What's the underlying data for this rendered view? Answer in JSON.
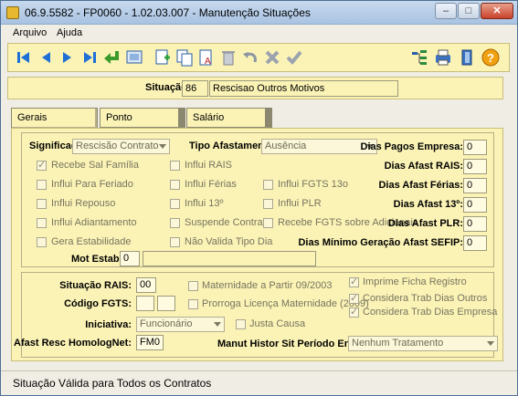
{
  "window": {
    "title": "06.9.5582 - FP0060 - 1.02.03.007 - Manutenção Situações"
  },
  "window_controls": {
    "minimize": "–",
    "maximize": "□",
    "close": "✕"
  },
  "menu": [
    "Arquivo",
    "Ajuda"
  ],
  "situacao": {
    "label": "Situação:",
    "code": "86",
    "description": "Rescisao Outros Motivos"
  },
  "tabs": [
    "Gerais",
    "Ponto",
    "Salário"
  ],
  "gerais": {
    "significado": {
      "label": "Significado:",
      "value": "Rescisão Contrato"
    },
    "tipo_afastamento": {
      "label": "Tipo Afastamento:",
      "value": "Ausência"
    },
    "checkboxes_col1": [
      {
        "label": "Recebe Sal Família",
        "checked": true
      },
      {
        "label": "Influi Para Feriado",
        "checked": false
      },
      {
        "label": "Influi Repouso",
        "checked": false
      },
      {
        "label": "Influi Adiantamento",
        "checked": false
      },
      {
        "label": "Gera Estabilidade",
        "checked": false
      }
    ],
    "checkboxes_col2": [
      {
        "label": "Influi RAIS",
        "checked": false
      },
      {
        "label": "Influi Férias",
        "checked": false
      },
      {
        "label": "Influi 13º",
        "checked": false
      },
      {
        "label": "Suspende Contrato",
        "checked": false
      },
      {
        "label": "Não Valida Tipo Dia",
        "checked": false
      }
    ],
    "checkboxes_col3": [
      {
        "label": "Influi FGTS 13o",
        "checked": false
      },
      {
        "label": "Influi PLR",
        "checked": false
      },
      {
        "label": "Recebe FGTS sobre Adicionais",
        "checked": false
      }
    ],
    "dias": [
      {
        "label": "Dias Pagos Empresa:",
        "value": "0"
      },
      {
        "label": "Dias Afast RAIS:",
        "value": "0"
      },
      {
        "label": "Dias Afast Férias:",
        "value": "0"
      },
      {
        "label": "Dias Afast 13º:",
        "value": "0"
      },
      {
        "label": "Dias Afast PLR:",
        "value": "0"
      },
      {
        "label": "Dias Mínimo Geração Afast SEFIP:",
        "value": "0"
      }
    ],
    "mot_estab": {
      "label": "Mot Estab:",
      "value": "0",
      "description": ""
    }
  },
  "lower": {
    "situacao_rais": {
      "label": "Situação RAIS:",
      "value": "00"
    },
    "codigo_fgts": {
      "label": "Código FGTS:",
      "value1": "",
      "value2": ""
    },
    "iniciativa": {
      "label": "Iniciativa:",
      "value": "Funcionário"
    },
    "afast_resc": {
      "label": "Afast Resc HomologNet:",
      "value": "FM0"
    },
    "manut_histor": {
      "label": "Manut Histor Sit Período Encer:",
      "value": "Nenhum Tratamento"
    },
    "checks_mid": [
      {
        "label": "Maternidade a Partir 09/2003",
        "checked": false
      },
      {
        "label": "Prorroga Licença Maternidade (2009)",
        "checked": false
      }
    ],
    "justa_causa": {
      "label": "Justa Causa",
      "checked": false
    },
    "checks_right": [
      {
        "label": "Imprime Ficha Registro",
        "checked": true
      },
      {
        "label": "Considera Trab Dias Outros",
        "checked": true
      },
      {
        "label": "Considera Trab Dias Empresa",
        "checked": true
      }
    ]
  },
  "status": {
    "text": "Situação Válida para Todos os Contratos"
  },
  "toolbar": {
    "icons": [
      "first-icon",
      "previous-icon",
      "next-icon",
      "last-icon",
      "enter-icon",
      "search-icon",
      "new-icon",
      "copy-icon",
      "edit-icon",
      "delete-icon",
      "undo-icon",
      "cancel-icon",
      "confirm-icon",
      "tree-icon",
      "print-icon",
      "exit-icon",
      "help-icon"
    ]
  }
}
